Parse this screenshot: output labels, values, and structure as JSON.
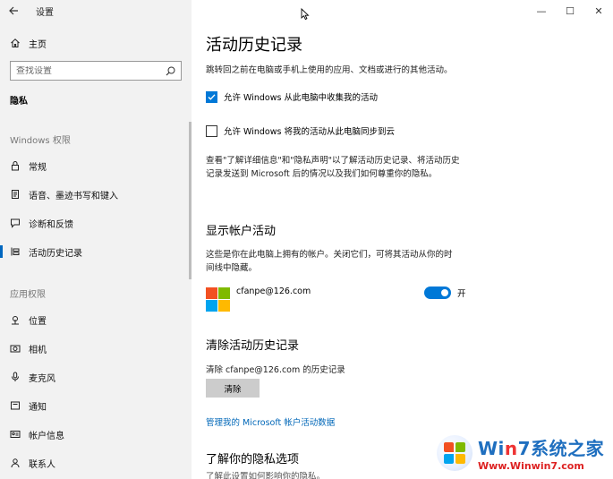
{
  "window": {
    "title": "设置",
    "minimize": "—",
    "maximize": "☐",
    "close": "✕"
  },
  "sidebar": {
    "home": "主页",
    "search_placeholder": "查找设置",
    "current_section": "隐私",
    "windows_header": "Windows 权限",
    "windows_items": [
      {
        "label": "常规",
        "icon": "lock-icon"
      },
      {
        "label": "语音、墨迹书写和键入",
        "icon": "document-icon"
      },
      {
        "label": "诊断和反馈",
        "icon": "feedback-icon"
      },
      {
        "label": "活动历史记录",
        "icon": "timeline-icon"
      }
    ],
    "app_header": "应用权限",
    "app_items": [
      {
        "label": "位置",
        "icon": "location-icon"
      },
      {
        "label": "相机",
        "icon": "camera-icon"
      },
      {
        "label": "麦克风",
        "icon": "microphone-icon"
      },
      {
        "label": "通知",
        "icon": "notification-icon"
      },
      {
        "label": "帐户信息",
        "icon": "account-info-icon"
      },
      {
        "label": "联系人",
        "icon": "contacts-icon"
      }
    ]
  },
  "main": {
    "title": "活动历史记录",
    "description": "跳转回之前在电脑或手机上使用的应用、文档或进行的其他活动。",
    "checkbox1": {
      "label": "允许 Windows 从此电脑中收集我的活动",
      "checked": true
    },
    "checkbox2": {
      "label": "允许 Windows 将我的活动从此电脑同步到云",
      "checked": false
    },
    "privacy_line1": "查看\"了解详细信息\"和\"隐私声明\"以了解活动历史记录、将活动历史",
    "privacy_line2": "记录发送到 Microsoft 后的情况以及我们如何尊重你的隐私。",
    "accounts_heading": "显示帐户活动",
    "accounts_line1": "这些是你在此电脑上拥有的帐户。关闭它们，可将其活动从你的时",
    "accounts_line2": "间线中隐藏。",
    "account_email": "cfanpe@126.com",
    "toggle_label": "开",
    "toggle_on": true,
    "clear_heading": "清除活动历史记录",
    "clear_desc": "清除 cfanpe@126.com 的历史记录",
    "clear_button": "清除",
    "manage_link": "管理我的 Microsoft 帐户活动数据",
    "learn_heading": "了解你的隐私选项",
    "learn_desc": "了解此设置如何影响你的隐私。"
  },
  "watermark": {
    "title_a": "Wi",
    "title_n": "n",
    "title_b": "7系统之家",
    "url": "Www.Winwin7.com"
  },
  "colors": {
    "accent": "#0078d7",
    "link": "#0067b8",
    "sidebar_bg": "#f2f2f2"
  }
}
